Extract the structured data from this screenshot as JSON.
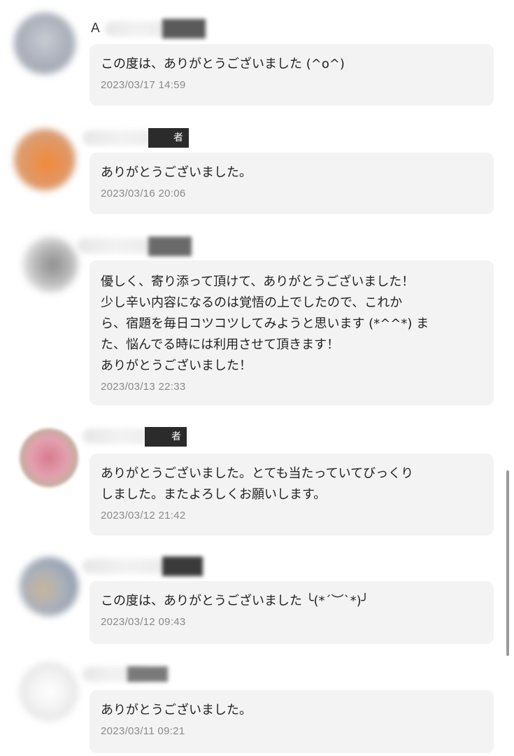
{
  "reviews": [
    {
      "name_prefix": "A",
      "badge": "",
      "message": "この度は、ありがとうございました (^o^)",
      "date": "2023/03/17 14:59"
    },
    {
      "name_prefix": "",
      "badge": "者",
      "message": "ありがとうございました。",
      "date": "2023/03/16 20:06"
    },
    {
      "name_prefix": "",
      "badge": "",
      "message": "優しく、寄り添って頂けて、ありがとうございました！\n少し辛い内容になるのは覚悟の上でしたので、これか\nら、宿題を毎日コツコツしてみようと思います (*^^*) ま\nた、悩んでる時には利用させて頂きます！\nありがとうございました！",
      "date": "2023/03/13 22:33"
    },
    {
      "name_prefix": "",
      "badge": "者",
      "message": "ありがとうございました。とても当たっていてびっくり\nしました。またよろしくお願いします。",
      "date": "2023/03/12 21:42"
    },
    {
      "name_prefix": "",
      "badge": "",
      "message": "この度は、ありがとうございました ╰(*´︶`*)╯",
      "date": "2023/03/12 09:43"
    },
    {
      "name_prefix": "",
      "badge": "",
      "message": "ありがとうございました。",
      "date": "2023/03/11 09:21"
    }
  ],
  "colors": {
    "bubble_bg": "#f3f3f3",
    "date_text": "#8a8a8a",
    "badge_bg": "#2b2b2b"
  }
}
